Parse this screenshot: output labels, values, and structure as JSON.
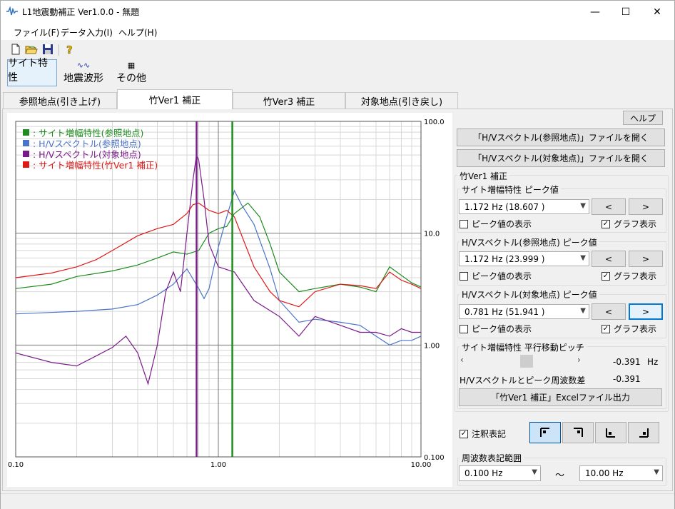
{
  "window": {
    "title": "L1地震動補正 Ver1.0.0 - 無題",
    "minimize": "—",
    "maximize": "☐",
    "close": "✕"
  },
  "menu": [
    "ファイル(F)",
    "データ入力(I)",
    "ヘルプ(H)"
  ],
  "toolbar": [
    "new-file-icon",
    "open-folder-icon",
    "save-icon",
    "help-icon"
  ],
  "modes": [
    {
      "label": "サイト特性",
      "icon": "site-characteristic-icon",
      "glyph": "⌒",
      "active": true
    },
    {
      "label": "地震波形",
      "icon": "waveform-icon",
      "glyph": "∿∿",
      "active": false
    },
    {
      "label": "その他",
      "icon": "table-icon",
      "glyph": "▦",
      "active": false
    }
  ],
  "tabs": [
    {
      "label": "参照地点(引き上げ)",
      "active": false
    },
    {
      "label": "竹Ver1 補正",
      "active": true
    },
    {
      "label": "竹Ver3 補正",
      "active": false
    },
    {
      "label": "対象地点(引き戻し)",
      "active": false
    }
  ],
  "right": {
    "help": "ヘルプ",
    "open_ref": "「H/Vスペクトル(参照地点)」ファイルを開く",
    "open_target": "「H/Vスペクトル(対象地点)」ファイルを開く",
    "group_title": "竹Ver1 補正",
    "peak_groups": [
      {
        "title": "サイト増幅特性 ピーク値",
        "value": "1.172 Hz (18.607 )",
        "show_peak": "ピーク値の表示",
        "show_peak_checked": false,
        "show_graph": "グラフ表示",
        "show_graph_checked": true
      },
      {
        "title": "H/Vスペクトル(参照地点) ピーク値",
        "value": "1.172 Hz (23.999 )",
        "show_peak": "ピーク値の表示",
        "show_peak_checked": false,
        "show_graph": "グラフ表示",
        "show_graph_checked": true
      },
      {
        "title": "H/Vスペクトル(対象地点) ピーク値",
        "value": "0.781 Hz (51.941 )",
        "show_peak": "ピーク値の表示",
        "show_peak_checked": false,
        "show_graph": "グラフ表示",
        "show_graph_checked": true
      }
    ],
    "prev": "<",
    "next": ">",
    "shift_group": "サイト増幅特性 平行移動ピッチ",
    "shift_value": "-0.391",
    "shift_unit": "Hz",
    "diff_label": "H/Vスペクトルとピーク周波数差",
    "diff_value": "-0.391",
    "export": "「竹Ver1 補正」Excelファイル出力",
    "annotation_label": "注釈表記",
    "annotation_checked": true,
    "corner_buttons": [
      "legend-top-left-icon",
      "legend-top-right-icon",
      "legend-bottom-left-icon",
      "legend-bottom-right-icon"
    ],
    "freq_group": "周波数表記範囲",
    "freq_from": "0.100 Hz",
    "freq_to": "10.00 Hz",
    "tilde": "～"
  },
  "chart_data": {
    "type": "line",
    "x_scale": "log",
    "y_scale": "log",
    "xlim": [
      0.1,
      10.0
    ],
    "ylim": [
      0.1,
      100.0
    ],
    "x_tick_labels": [
      "0.10",
      "1.00",
      "10.00"
    ],
    "y_tick_labels": [
      "100.0",
      "10.0",
      "1.00",
      "0.100"
    ],
    "legend_position": "top-left",
    "grid": true,
    "series": [
      {
        "name": ": サイト増幅特性(参照地点)",
        "color": "#1e8c1e",
        "x": [
          0.1,
          0.15,
          0.2,
          0.3,
          0.4,
          0.5,
          0.6,
          0.7,
          0.8,
          0.9,
          1.0,
          1.1,
          1.2,
          1.4,
          1.6,
          1.8,
          2.0,
          2.5,
          3,
          4,
          5,
          6,
          7,
          8,
          9,
          10
        ],
        "y": [
          3.2,
          3.5,
          4.1,
          4.6,
          5.2,
          6.0,
          6.8,
          6.5,
          7.0,
          10.0,
          11.0,
          11.5,
          15.0,
          18.6,
          14.0,
          8.0,
          4.5,
          3.0,
          3.2,
          3.5,
          3.3,
          3.0,
          5.0,
          4.2,
          3.6,
          3.3
        ]
      },
      {
        "name": ": H/Vスペクトル(参照地点)",
        "color": "#4a74c8",
        "x": [
          0.1,
          0.2,
          0.3,
          0.4,
          0.5,
          0.6,
          0.7,
          0.8,
          0.85,
          0.9,
          1.0,
          1.1,
          1.2,
          1.3,
          1.5,
          1.8,
          2.0,
          2.5,
          3,
          4,
          5,
          6,
          7,
          8,
          9,
          10
        ],
        "y": [
          1.9,
          2.0,
          2.1,
          2.3,
          2.8,
          3.5,
          4.8,
          3.2,
          2.6,
          3.2,
          7.5,
          14.0,
          24.0,
          18.0,
          12.0,
          4.8,
          2.5,
          1.6,
          1.7,
          1.6,
          1.5,
          1.2,
          1.0,
          1.1,
          1.1,
          1.2
        ]
      },
      {
        "name": ": H/Vスペクトル(対象地点)",
        "color": "#7a1a8a",
        "x": [
          0.1,
          0.15,
          0.2,
          0.3,
          0.35,
          0.4,
          0.45,
          0.5,
          0.55,
          0.6,
          0.65,
          0.7,
          0.75,
          0.78,
          0.8,
          0.85,
          0.9,
          1.0,
          1.2,
          1.5,
          2.0,
          2.5,
          3,
          4,
          5,
          6,
          7,
          8,
          9,
          10
        ],
        "y": [
          0.85,
          0.7,
          0.65,
          0.95,
          1.2,
          0.85,
          0.45,
          1.0,
          3.0,
          4.5,
          3.0,
          10.0,
          30.0,
          50.0,
          45.0,
          20.0,
          8.0,
          5.0,
          4.5,
          2.5,
          1.8,
          1.2,
          1.8,
          1.5,
          1.3,
          1.3,
          1.2,
          1.4,
          1.3,
          1.3
        ]
      },
      {
        "name": ": サイト増幅特性(竹Ver1 補正)",
        "color": "#e01818",
        "x": [
          0.1,
          0.15,
          0.2,
          0.25,
          0.3,
          0.4,
          0.5,
          0.6,
          0.7,
          0.75,
          0.8,
          0.9,
          1.0,
          1.1,
          1.2,
          1.5,
          1.8,
          2.0,
          2.5,
          3,
          4,
          5,
          6,
          7,
          8,
          9,
          10
        ],
        "y": [
          4.0,
          4.4,
          5.0,
          5.8,
          7.0,
          9.5,
          11.0,
          12.0,
          15.0,
          18.0,
          18.6,
          16.0,
          15.0,
          16.0,
          14.0,
          5.0,
          3.0,
          2.5,
          2.2,
          3.0,
          3.5,
          3.4,
          3.2,
          4.5,
          3.8,
          3.5,
          3.2
        ]
      }
    ],
    "vlines": [
      {
        "x": 0.781,
        "color": "#7a1a8a"
      },
      {
        "x": 1.172,
        "color": "#1e8c1e"
      }
    ]
  }
}
